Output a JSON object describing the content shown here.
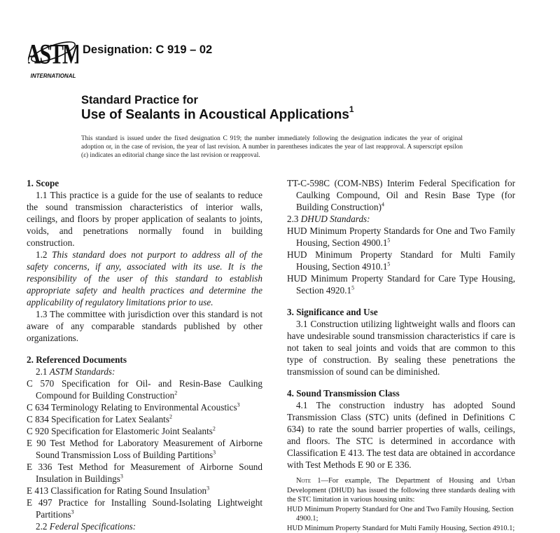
{
  "header": {
    "logo_text": "INTERNATIONAL",
    "logo_letters": "ASTM",
    "designation": "Designation: C 919 – 02"
  },
  "title": {
    "line1": "Standard Practice for",
    "line2": "Use of Sealants in Acoustical Applications",
    "footnote_mark": "1"
  },
  "intro": "This standard is issued under the fixed designation C 919; the number immediately following the designation indicates the year of original adoption or, in the case of revision, the year of last revision. A number in parentheses indicates the year of last reapproval. A superscript epsilon (ε) indicates an editorial change since the last revision or reapproval.",
  "scope": {
    "heading": "1.  Scope",
    "p1": "1.1  This practice is a guide for the use of sealants to reduce the sound transmission characteristics of interior walls, ceilings, and floors by proper application of sealants to joints, voids, and penetrations normally found in building construction.",
    "p2_num": "1.2 ",
    "p2": "This standard does not purport to address all of the safety concerns, if any, associated with its use. It is the responsibility of the user of this standard to establish appropriate safety and health practices and determine the applicability of regulatory limitations prior to use.",
    "p3": "1.3  The committee with jurisdiction over this standard is not aware of any comparable standards published by other organizations."
  },
  "referenced": {
    "heading": "2.  Referenced Documents",
    "astm_num": "2.1  ",
    "astm_label": "ASTM Standards:",
    "astm": [
      {
        "text": "C 570  Specification for Oil- and Resin-Base Caulking Compound for Building Construction",
        "fn": "2"
      },
      {
        "text": "C 634  Terminology Relating to Environmental Acoustics",
        "fn": "3"
      },
      {
        "text": "C 834  Specification for Latex Sealants",
        "fn": "2"
      },
      {
        "text": "C 920  Specification for Elastomeric Joint Sealants",
        "fn": "2"
      },
      {
        "text": "E 90  Test Method for Laboratory Measurement of Airborne Sound Transmission Loss of Building Partitions",
        "fn": "3"
      },
      {
        "text": "E 336  Test Method for Measurement of Airborne Sound Insulation in Buildings",
        "fn": "3"
      },
      {
        "text": "E 413  Classification for Rating Sound Insulation",
        "fn": "3"
      },
      {
        "text": "E 497  Practice for Installing Sound-Isolating Lightweight Partitions",
        "fn": "3"
      }
    ],
    "federal_num": "2.2  ",
    "federal_label": "Federal Specifications:",
    "federal": [
      {
        "text": "TT-C-598C (COM-NBS) Interim Federal Specification for Caulking Compound, Oil and Resin Base Type (for Building Construction)",
        "fn": "4"
      }
    ],
    "dhud_num": "2.3  ",
    "dhud_label": "DHUD Standards:",
    "dhud": [
      {
        "text": "HUD Minimum Property Standards for One and Two Family Housing, Section 4900.1",
        "fn": "5"
      },
      {
        "text": "HUD Minimum Property Standard for Multi Family Housing, Section 4910.1",
        "fn": "5"
      },
      {
        "text": "HUD Minimum Property Standard for Care Type Housing, Section 4920.1",
        "fn": "5"
      }
    ]
  },
  "significance": {
    "heading": "3.  Significance and Use",
    "p1": "3.1  Construction utilizing lightweight walls and floors can have undesirable sound transmission characteristics if care is not taken to seal joints and voids that are common to this type of construction. By sealing these penetrations the transmission of sound can be diminished."
  },
  "stc": {
    "heading": "4.  Sound Transmission Class",
    "p1": "4.1  The construction industry has adopted Sound Transmission Class (STC) units (defined in Definitions C 634) to rate the sound barrier properties of walls, ceilings, and floors. The STC is determined in accordance with Classification E 413. The test data are obtained in accordance with Test Methods E 90 or E 336.",
    "note_label": "Note",
    "note_text": " 1—For example, The Department of Housing and Urban Development (DHUD) has issued the following three standards dealing with the STC limitation in various housing units:",
    "note_refs": [
      "HUD Minimum Property Standard for One and Two Family Housing, Section 4900.1;",
      "HUD Minimum Property Standard for Multi Family Housing, Section 4910.1;"
    ]
  }
}
